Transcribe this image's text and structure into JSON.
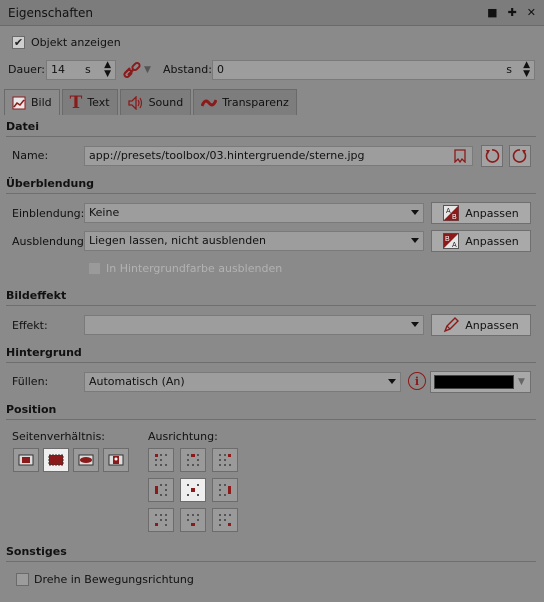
{
  "window": {
    "title": "Eigenschaften",
    "controls": [
      "■",
      "✚",
      "✕"
    ]
  },
  "general": {
    "show_object_label": "Objekt anzeigen",
    "show_object_checked": true,
    "duration_label": "Dauer:",
    "duration_value": "14",
    "duration_unit": "s",
    "distance_label": "Abstand:",
    "distance_value": "0",
    "distance_unit": "s"
  },
  "tabs": [
    {
      "label": "Bild",
      "icon": "image-icon",
      "active": true
    },
    {
      "label": "Text",
      "icon": "text-icon",
      "active": false
    },
    {
      "label": "Sound",
      "icon": "speaker-icon",
      "active": false
    },
    {
      "label": "Transparenz",
      "icon": "transparency-icon",
      "active": false
    }
  ],
  "datei": {
    "header": "Datei",
    "name_label": "Name:",
    "name_value": "app://presets/toolbox/03.hintergruende/sterne.jpg"
  },
  "ueberblendung": {
    "header": "Überblendung",
    "in_label": "Einblendung:",
    "in_value": "Keine",
    "in_button": "Anpassen",
    "out_label": "Ausblendung:",
    "out_value": "Liegen lassen, nicht ausblenden",
    "out_button": "Anpassen",
    "bg_color_label": "In Hintergrundfarbe ausblenden",
    "bg_color_checked": false,
    "bg_color_enabled": false
  },
  "bildeffekt": {
    "header": "Bildeffekt",
    "effect_label": "Effekt:",
    "effect_value": "",
    "button": "Anpassen"
  },
  "hintergrund": {
    "header": "Hintergrund",
    "fill_label": "Füllen:",
    "fill_value": "Automatisch (An)",
    "color": "#000000"
  },
  "position": {
    "header": "Position",
    "aspect_label": "Seitenverhältnis:",
    "align_label": "Ausrichtung:",
    "aspect_active_index": 1,
    "align_active": "center"
  },
  "sonstiges": {
    "header": "Sonstiges",
    "rotate_label": "Drehe in Bewegungsrichtung",
    "rotate_checked": false
  },
  "colors": {
    "accent": "#8b1a1a",
    "panel_bg": "#8a8a8a"
  }
}
